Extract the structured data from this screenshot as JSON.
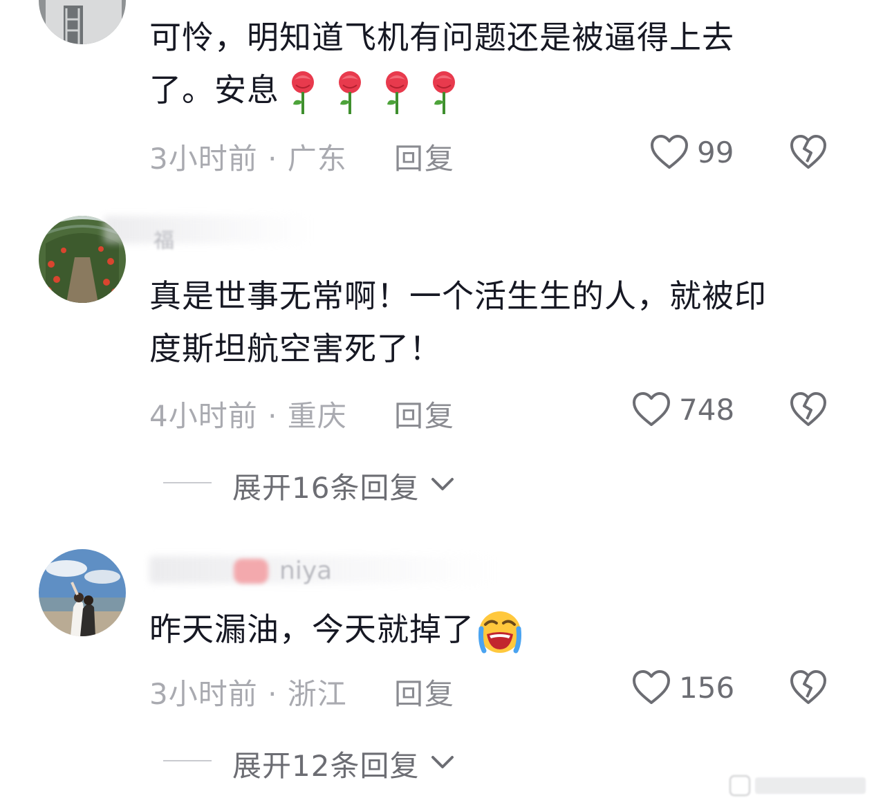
{
  "comments": [
    {
      "text_line1": "可怜，明知道飞机有问题还是被逼得上去",
      "text_line2": "了。安息",
      "emoji": "rose-emoji",
      "time": "3小时前",
      "location": "广东",
      "reply_label": "回复",
      "likes": "99"
    },
    {
      "username_fragment": "福",
      "text_line1": "真是世事无常啊！一个活生生的人，就被印",
      "text_line2": "度斯坦航空害死了！",
      "time": "4小时前",
      "location": "重庆",
      "reply_label": "回复",
      "likes": "748",
      "expand_label": "展开16条回复"
    },
    {
      "username_fragment": "niya",
      "text_line1": "昨天漏油，今天就掉了",
      "emoji": "loudly-crying-face-emoji",
      "time": "3小时前",
      "location": "浙江",
      "reply_label": "回复",
      "likes": "156",
      "expand_label": "展开12条回复"
    }
  ],
  "separator": " · ",
  "icons": {
    "like": "heart-outline-icon",
    "dislike": "broken-heart-icon",
    "expand": "chevron-down-icon"
  },
  "colors": {
    "text": "#161823",
    "meta": "#a9aab0",
    "secondary": "#6c6d73"
  }
}
